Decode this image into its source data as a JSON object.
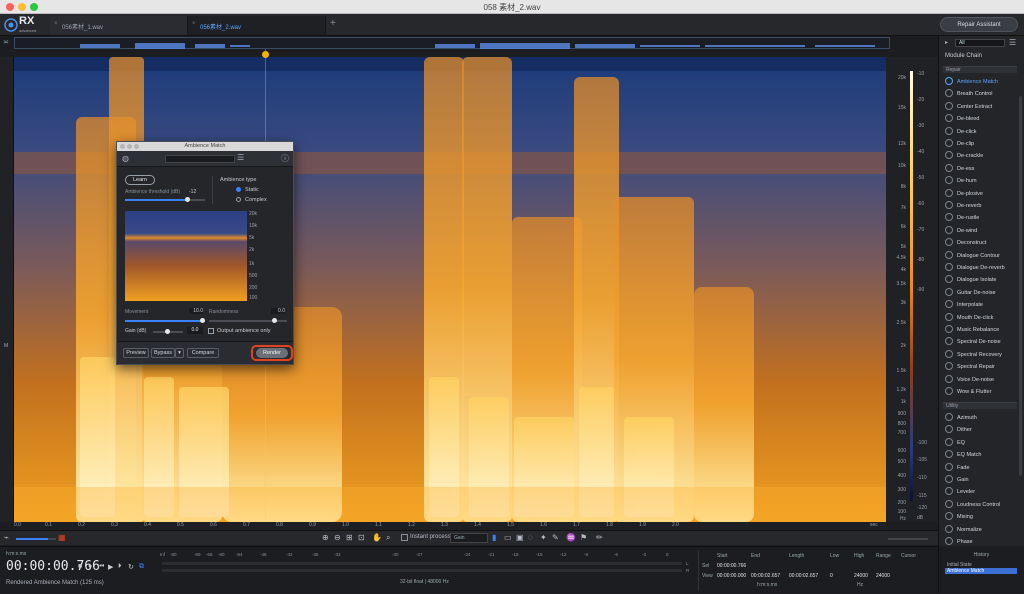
{
  "window": {
    "title": "058 素材_2.wav"
  },
  "app": {
    "name": "RX",
    "edition": "advanced"
  },
  "tabs": [
    {
      "label": "056素材_1.wav",
      "active": false
    },
    {
      "label": "056素材_2.wav",
      "active": true
    }
  ],
  "header": {
    "repair_assistant": "Repair Assistant"
  },
  "spectrogram": {
    "freq_ticks": [
      "20k",
      "15k",
      "12k",
      "10k",
      "8k",
      "7k",
      "6k",
      "5k",
      "4.5k",
      "4k",
      "3.5k",
      "3k",
      "2.5k",
      "2k",
      "1.5k",
      "1.2k",
      "1k",
      "900",
      "800",
      "700",
      "600",
      "500",
      "400",
      "300",
      "200",
      "100",
      "Hz"
    ],
    "db_ticks": [
      "-10",
      "-20",
      "-30",
      "-40",
      "-50",
      "-60",
      "-70",
      "-80",
      "-90",
      "-100",
      "-105",
      "-110",
      "-115",
      "-120"
    ],
    "db_label": "dB",
    "time_ticks": [
      "0.0",
      "0.1",
      "0.2",
      "0.3",
      "0.4",
      "0.5",
      "0.6",
      "0.7",
      "0.8",
      "0.9",
      "1.0",
      "1.1",
      "1.2",
      "1.3",
      "1.4",
      "1.5",
      "1.6",
      "1.7",
      "1.8",
      "1.9",
      "2.0",
      "sec"
    ],
    "channel_label": "M"
  },
  "toolbar": {
    "instant_process": "Instant process",
    "gain_mode": "Gain"
  },
  "transport": {
    "timecode_format": "h:m:s.ms",
    "timecode": "00:00:00.766",
    "status": "Rendered Ambience Match (125 ms)",
    "format": "32-bit float | 48000 Hz"
  },
  "meter": {
    "ticks": [
      "Inf",
      "-80",
      "-69",
      "-66",
      "-60",
      "-54",
      "-48",
      "-42",
      "-36",
      "-33",
      "-30",
      "-27",
      "-24",
      "-21",
      "-18",
      "-15",
      "-12",
      "-9",
      "-6",
      "-3",
      "0"
    ],
    "channel_l": "L",
    "channel_r": "R"
  },
  "selection": {
    "headers": [
      "Start",
      "End",
      "Length",
      "Low",
      "High",
      "Range",
      "Cursor"
    ],
    "sel_label": "Sel",
    "view_label": "View",
    "sel": [
      "00:00:00.766",
      "",
      "",
      "",
      "",
      "",
      ""
    ],
    "view": [
      "00:00:00.000",
      "00:00:02.657",
      "00:00:02.657",
      "0",
      "24000",
      "24000",
      ""
    ],
    "unit_time": "h:m:s.ms",
    "unit_freq": "Hz"
  },
  "history": {
    "title": "History",
    "items": [
      {
        "label": "Initial State",
        "active": false
      },
      {
        "label": "Ambience Match",
        "active": true
      }
    ]
  },
  "modules": {
    "filter": "All",
    "chain": "Module Chain",
    "repair_section": "Repair",
    "repair": [
      "Ambience Match",
      "Breath Control",
      "Center Extract",
      "De-bleed",
      "De-click",
      "De-clip",
      "De-crackle",
      "De-ess",
      "De-hum",
      "De-plosive",
      "De-reverb",
      "De-rustle",
      "De-wind",
      "Deconstruct",
      "Dialogue Contour",
      "Dialogue De-reverb",
      "Dialogue Isolate",
      "Guitar De-noise",
      "Interpolate",
      "Mouth De-click",
      "Music Rebalance",
      "Spectral De-noise",
      "Spectral Recovery",
      "Spectral Repair",
      "Voice De-noise",
      "Wow & Flutter"
    ],
    "active": "Ambience Match",
    "utility_section": "Utility",
    "utility": [
      "Azimuth",
      "Dither",
      "EQ",
      "EQ Match",
      "Fade",
      "Gain",
      "Leveler",
      "Loudness Control",
      "Mixing",
      "Normalize",
      "Phase"
    ]
  },
  "ambience_match": {
    "title": "Ambience Match",
    "learn": "Learn",
    "threshold_label": "Ambience threshold (dB)",
    "threshold_value": "-12",
    "type_label": "Ambience type",
    "type_static": "Static",
    "type_complex": "Complex",
    "spec_ticks": [
      "20k",
      "10k",
      "5k",
      "2k",
      "1k",
      "500",
      "200",
      "100"
    ],
    "movement_label": "Movement",
    "movement_value": "10.0",
    "randomness_label": "Randomness",
    "randomness_value": "0.0",
    "gain_label": "Gain (dB)",
    "gain_value": "0.0",
    "output_label": "Output ambience only",
    "preview": "Preview",
    "bypass": "Bypass",
    "compare": "Compare",
    "render": "Render"
  },
  "colors": {
    "accent": "#3b82f6",
    "highlight": "#e0431f",
    "playhead": "#f0b400"
  }
}
